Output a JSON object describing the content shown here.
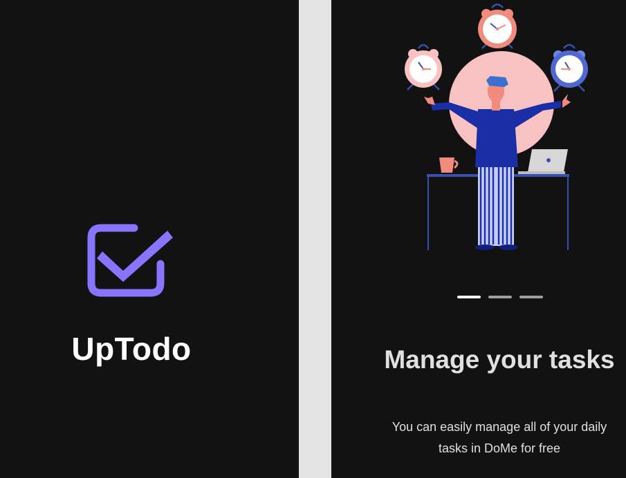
{
  "splash": {
    "app_name": "UpTodo",
    "logo_icon": "checkbox-checked-icon",
    "accent_color": "#8875ff"
  },
  "onboarding": {
    "illustration": "person-juggling-alarm-clocks",
    "pager": {
      "total": 3,
      "active_index": 0
    },
    "title": "Manage your tasks",
    "description": "You can easily manage all of your daily tasks in DoMe for free"
  },
  "colors": {
    "background": "#121212",
    "divider": "#e5e5e5",
    "text": "#ffffff",
    "indicator_inactive": "#9e9e9e"
  }
}
